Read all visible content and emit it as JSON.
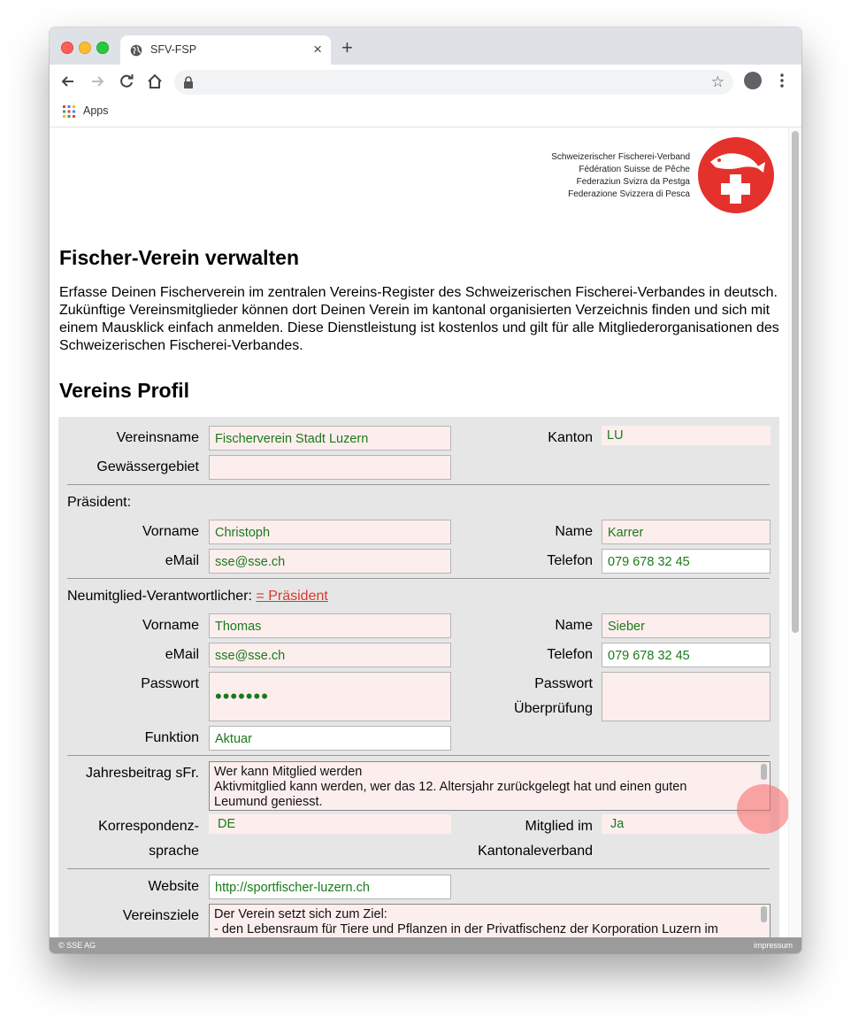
{
  "browser": {
    "tab_title": "SFV-FSP",
    "tab_close": "×",
    "new_tab": "+",
    "star": "☆",
    "bookmarks": {
      "apps_label": "Apps"
    }
  },
  "header": {
    "org_names": [
      "Schweizerischer Fischerei-Verband",
      "Fédération Suisse de Pêche",
      "Federaziun Svizra da Pestga",
      "Federazione Svizzera di Pesca"
    ]
  },
  "page": {
    "title": "Fischer-Verein verwalten",
    "intro": "Erfasse Deinen Fischerverein im zentralen Vereins-Register des Schweizerischen Fischerei-Verbandes in deutsch. Zukünftige Vereinsmitglieder können dort Deinen Verein im kantonal organisierten Verzeichnis finden und sich mit einem Mausklick einfach anmelden. Diese Dienstleistung ist kostenlos und gilt für alle Mitgliederorganisationen des Schweizerischen Fischerei-Verbandes.",
    "profile_heading": "Vereins Profil"
  },
  "form": {
    "vereinsname": {
      "label": "Vereinsname",
      "value": "Fischerverein Stadt Luzern"
    },
    "kanton": {
      "label": "Kanton",
      "value": "LU"
    },
    "gewaessergebiet": {
      "label": "Gewässergebiet",
      "value": ""
    },
    "praesident": {
      "section": "Präsident:",
      "vorname": {
        "label": "Vorname",
        "value": "Christoph"
      },
      "name": {
        "label": "Name",
        "value": "Karrer"
      },
      "email": {
        "label": "eMail",
        "value": "sse@sse.ch"
      },
      "telefon": {
        "label": "Telefon",
        "value": "079 678 32 45"
      }
    },
    "neumitglied": {
      "section": "Neumitglied-Verantwortlicher:",
      "link": "= Präsident",
      "vorname": {
        "label": "Vorname",
        "value": "Thomas"
      },
      "name": {
        "label": "Name",
        "value": "Sieber"
      },
      "email": {
        "label": "eMail",
        "value": "sse@sse.ch"
      },
      "telefon": {
        "label": "Telefon",
        "value": "079 678 32 45"
      },
      "passwort": {
        "label": "Passwort",
        "value": "•••••••"
      },
      "passwort_check": {
        "label1": "Passwort",
        "label2": "Überprüfung",
        "value": ""
      },
      "funktion": {
        "label": "Funktion",
        "value": "Aktuar"
      }
    },
    "jahresbeitrag": {
      "label": "Jahresbeitrag sFr.",
      "lines": [
        "Wer kann Mitglied werden",
        "Aktivmitglied kann werden, wer das 12. Altersjahr zurückgelegt hat und einen guten",
        "Leumund geniesst."
      ]
    },
    "korrespondenz": {
      "label1": "Korrespondenz-",
      "label2": "sprache",
      "value": "DE"
    },
    "mitglied_kv": {
      "label1": "Mitglied im",
      "label2": "Kantonaleverband",
      "value": "Ja"
    },
    "website": {
      "label": "Website",
      "value": "http://sportfischer-luzern.ch"
    },
    "vereinsziele": {
      "label": "Vereinsziele",
      "lines": [
        "Der Verein setzt sich zum Ziel:",
        "- den Lebensraum für Tiere und Pflanzen in der Privatfischenz der Korporation Luzern im"
      ]
    }
  },
  "footer": {
    "left": "© SSE AG",
    "right": "impressum"
  },
  "colors": {
    "accent": "#d83a2a",
    "input_bg": "#fdeeee",
    "value_text": "#1a7a1a",
    "form_bg": "#e6e6e6"
  }
}
